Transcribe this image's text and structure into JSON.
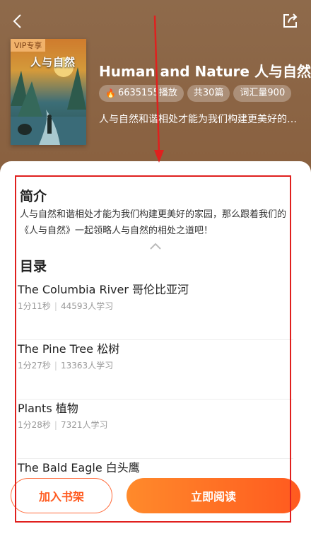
{
  "book": {
    "cover_badge": "VIP专享",
    "cover_title": "人与自然",
    "title": "Human and Nature 人与自然",
    "plays": "6635155播放",
    "episodes": "共30篇",
    "vocab": "词汇量900",
    "subtitle": "人与自然和谐相处才能为我们构建更美好的家园，那么跟着我们的《人与自然》一起领略人与自然的相处之道吧！"
  },
  "intro": {
    "heading": "简介",
    "text": "人与自然和谐相处才能为我们构建更美好的家园，那么跟着我们的《人与自然》一起领略人与自然的相处之道吧！"
  },
  "toc": {
    "heading": "目录",
    "chapters": [
      {
        "title": "The Columbia River 哥伦比亚河",
        "duration": "1分11秒",
        "learners": "44593人学习"
      },
      {
        "title": "The Pine Tree 松树",
        "duration": "1分27秒",
        "learners": "13363人学习"
      },
      {
        "title": "Plants 植物",
        "duration": "1分28秒",
        "learners": "7321人学习"
      },
      {
        "title": "The Bald Eagle 白头鹰",
        "duration": "",
        "learners": ""
      }
    ]
  },
  "actions": {
    "add_to_shelf": "加入书架",
    "read_now": "立即阅读"
  },
  "icons": {
    "back": "back-arrow-icon",
    "share": "share-icon",
    "flame": "flame-icon",
    "collapse": "chevron-up-icon"
  },
  "colors": {
    "header_bg": "#8b6446",
    "accent": "#ff5a1f",
    "annotation": "#e0201e"
  }
}
